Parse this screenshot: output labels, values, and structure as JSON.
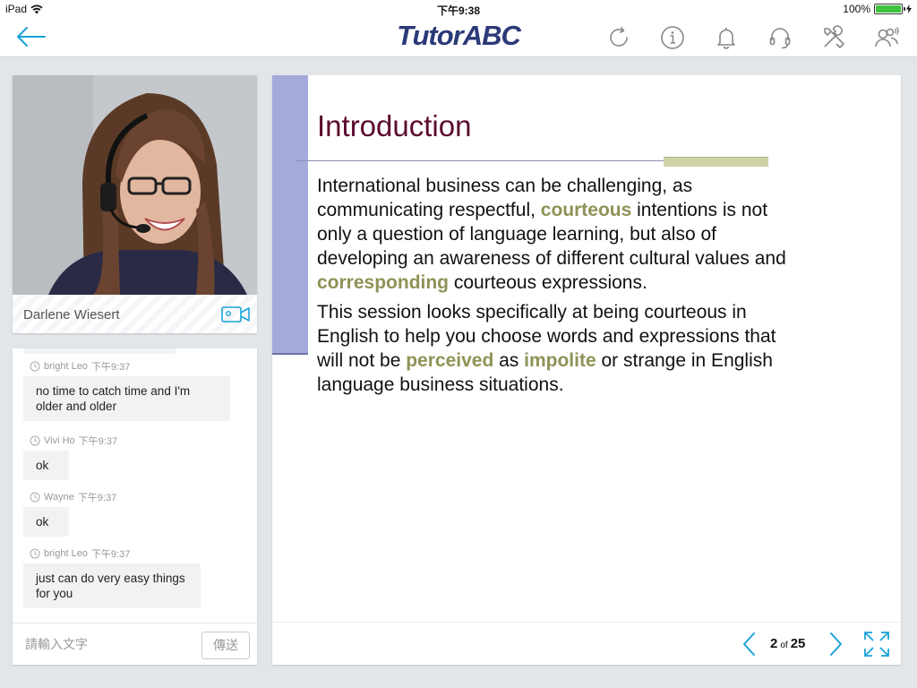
{
  "status_bar": {
    "device": "iPad",
    "time": "下午9:38",
    "battery": "100%",
    "battery_level": 1.0
  },
  "nav": {
    "logo": "TutorABC",
    "icons": [
      "back-arrow-icon",
      "refresh-icon",
      "info-icon",
      "bell-icon",
      "headset-icon",
      "tools-icon",
      "participants-icon"
    ]
  },
  "video": {
    "presenter_name": "Darlene Wiesert"
  },
  "chat": {
    "messages": [
      {
        "sender": "bright Leo",
        "time": "下午9:37",
        "text": "no time to catch time and I'm older and older"
      },
      {
        "sender": "Vivi Ho",
        "time": "下午9:37",
        "text": "ok"
      },
      {
        "sender": "Wayne",
        "time": "下午9:37",
        "text": "ok"
      },
      {
        "sender": "bright Leo",
        "time": "下午9:37",
        "text": "just can do very easy things for you"
      }
    ],
    "input_placeholder": "請輸入文字",
    "send_label": "傳送"
  },
  "slide": {
    "title": "Introduction",
    "p1": {
      "a": "International business can be challenging, as communicating respectful, ",
      "h1": "courteous",
      "b": " intentions is not only a question of language learning, but also of developing an awareness of different cultural values and ",
      "h2": "corresponding",
      "c": " courteous expressions."
    },
    "p2": {
      "a": "This session looks specifically at being courteous in English to help you choose words and expressions that will not be ",
      "h1": "perceived",
      "b": " as ",
      "h2": "impolite",
      "c": " or strange in English language business situations."
    },
    "colors": {
      "title": "#5c0b2e",
      "highlight": "#8f9256",
      "bar": "#a4abdb"
    }
  },
  "pager": {
    "current": "2",
    "of": "of",
    "total": "25"
  },
  "colors": {
    "accent": "#1aa3d9",
    "logo": "#2b3a78"
  }
}
